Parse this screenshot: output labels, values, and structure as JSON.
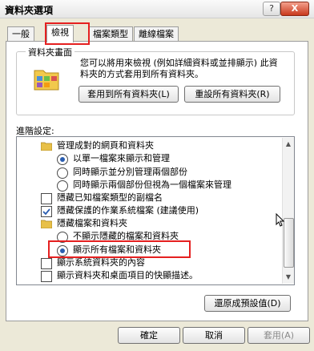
{
  "window": {
    "title": "資料夾選項",
    "help_label": "?",
    "close_label": "X"
  },
  "tabs": [
    {
      "label": "一般"
    },
    {
      "label": "檢視"
    },
    {
      "label": "檔案類型"
    },
    {
      "label": "離線檔案"
    }
  ],
  "folder_views": {
    "group_title": "資料夾畫面",
    "description": "您可以將用來檢視 (例如詳細資料或並排顯示) 此資料夾的方式套用到所有資料夾。",
    "apply_all_label": "套用到所有資料夾(L)",
    "reset_all_label": "重設所有資料夾(R)"
  },
  "advanced": {
    "title": "進階設定:",
    "items": [
      {
        "type": "folder",
        "label": "管理成對的網頁和資料夾"
      },
      {
        "type": "radio",
        "label": "以單一檔案來顯示和管理",
        "checked": true
      },
      {
        "type": "radio",
        "label": "同時顯示並分別管理兩個部份",
        "checked": false
      },
      {
        "type": "radio",
        "label": "同時顯示兩個部份但視為一個檔案來管理",
        "checked": false
      },
      {
        "type": "checkbox",
        "label": "隱藏已知檔案類型的副檔名",
        "checked": false
      },
      {
        "type": "checkbox",
        "label": "隱藏保護的作業系統檔案 (建議使用)",
        "checked": true
      },
      {
        "type": "folder",
        "label": "隱藏檔案和資料夾"
      },
      {
        "type": "radio",
        "label": "不顯示隱藏的檔案和資料夾",
        "checked": false
      },
      {
        "type": "radio",
        "label": "顯示所有檔案和資料夾",
        "checked": true
      },
      {
        "type": "checkbox",
        "label": "顯示系統資料夾的內容",
        "checked": false
      },
      {
        "type": "checkbox",
        "label": "顯示資料夾和桌面項目的快顯描述。",
        "checked": false
      }
    ]
  },
  "restore_defaults_label": "還原成預設值(D)",
  "footer": {
    "ok_label": "確定",
    "cancel_label": "取消",
    "apply_label": "套用(A)"
  },
  "colors": {
    "highlight": "#e52020",
    "radio_selected": "#2a5db0",
    "folder": "#e8c048"
  }
}
